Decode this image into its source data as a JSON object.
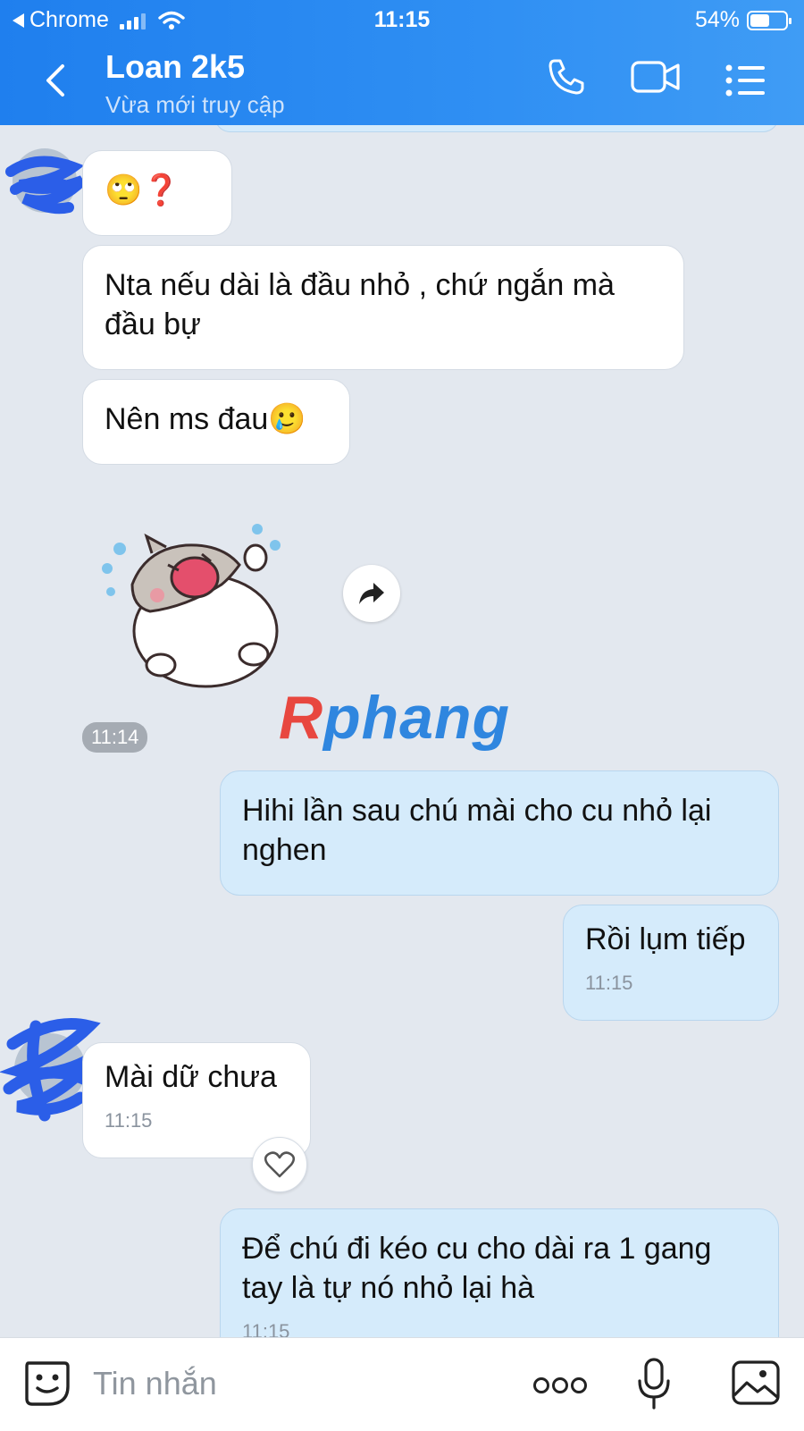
{
  "status_bar": {
    "carrier": "Chrome",
    "time": "11:15",
    "battery": "54%",
    "battery_level": 0.54
  },
  "header": {
    "title": "Loan 2k5",
    "subtitle": "Vừa mới truy cập",
    "icons": [
      "back-icon",
      "phone-icon",
      "video-call-icon",
      "menu-icon"
    ]
  },
  "messages": [
    {
      "from": "them",
      "text": "🙄❓"
    },
    {
      "from": "them",
      "text": "Nta nếu dài là đầu nhỏ , chứ ngắn mà đầu bự"
    },
    {
      "from": "them",
      "text": "Nên ms đau🥲"
    },
    {
      "from": "them",
      "type": "sticker",
      "time": "11:14"
    },
    {
      "from": "me",
      "text": "Hihi lần sau chú mài cho cu nhỏ lại nghen"
    },
    {
      "from": "me",
      "text": "Rồi lụm tiếp",
      "time": "11:15"
    },
    {
      "from": "them",
      "text": "Mài dữ chưa",
      "time": "11:15"
    },
    {
      "from": "me",
      "text": "Để chú đi kéo cu cho dài ra 1 gang tay là tự nó nhỏ lại hà",
      "time": "11:15"
    }
  ],
  "watermark": {
    "first": "R",
    "rest": "phang"
  },
  "composer": {
    "placeholder": "Tin nhắn",
    "icons": [
      "sticker-icon",
      "more-icon",
      "microphone-icon",
      "image-icon"
    ]
  },
  "colors": {
    "header": "#2f8ff3",
    "chat_bg": "#e3e8ef",
    "my_bubble": "#d5ebfb",
    "their_bubble": "#ffffff"
  }
}
